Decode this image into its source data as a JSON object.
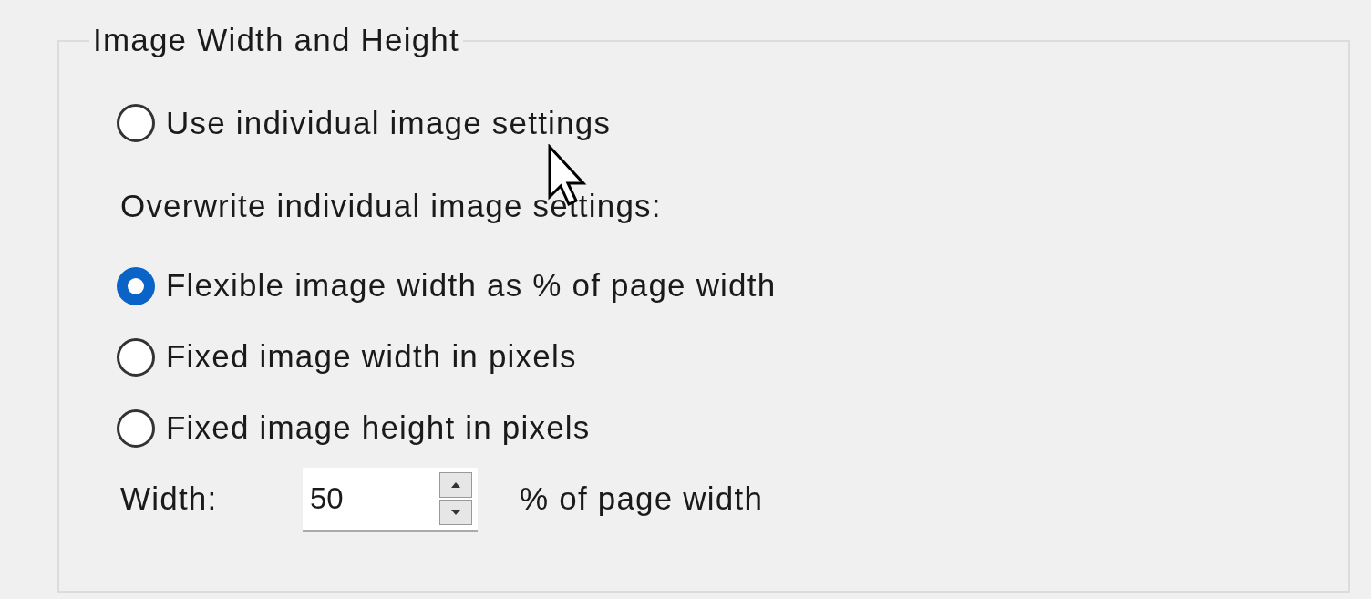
{
  "group": {
    "title": "Image Width and Height"
  },
  "mode_options": [
    {
      "label": "Use individual image settings",
      "selected": false
    }
  ],
  "overwrite_heading": "Overwrite individual image settings:",
  "overwrite_options": [
    {
      "label": "Flexible image width as % of page width",
      "selected": true
    },
    {
      "label": "Fixed image width in pixels",
      "selected": false
    },
    {
      "label": "Fixed image height in pixels",
      "selected": false
    }
  ],
  "width": {
    "label": "Width:",
    "value": "50",
    "unit": "% of page width"
  }
}
